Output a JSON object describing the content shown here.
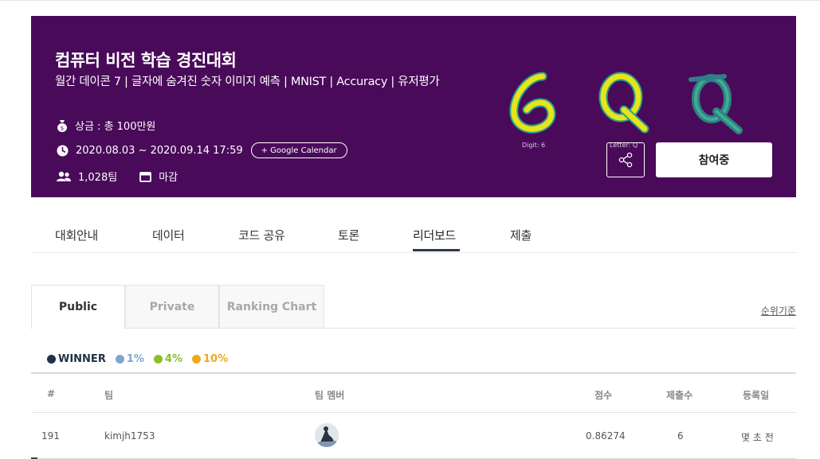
{
  "banner": {
    "title": "컴퓨터 비전 학습 경진대회",
    "subtitle": "월간 데이콘 7 | 글자에 숨겨진 숫자 이미지 예측 | MNIST | Accuracy | 유저평가",
    "prize": "상금 : 총 100만원",
    "period": "2020.08.03 ~ 2020.09.14 17:59",
    "calendar_button": "+ Google Calendar",
    "teams": "1,028팀",
    "status": "마감",
    "caption_digit": "Digit: 6",
    "caption_letter": "Letter: Q",
    "share_icon": "share-icon",
    "join_button": "참여중",
    "colors": {
      "background": "#4a0a5a",
      "digit_fill": "#e5e51a",
      "digit_edge": "#2a9d8f"
    }
  },
  "nav": {
    "items": [
      "대회안내",
      "데이터",
      "코드 공유",
      "토론",
      "리더보드",
      "제출"
    ],
    "active_index": 4
  },
  "leaderboard": {
    "tabs": [
      "Public",
      "Private",
      "Ranking Chart"
    ],
    "active_tab": 0,
    "sort_link": "순위기준",
    "legend": [
      {
        "label": "WINNER",
        "color": "#1f3147"
      },
      {
        "label": "1%",
        "color": "#7ba7cf"
      },
      {
        "label": "4%",
        "color": "#8cbf26"
      },
      {
        "label": "10%",
        "color": "#f0a81c"
      }
    ],
    "columns": [
      "#",
      "팀",
      "팀 멤버",
      "점수",
      "제출수",
      "등록일"
    ],
    "rows": [
      {
        "rank": "191",
        "team": "kimjh1753",
        "score": "0.86274",
        "submissions": "6",
        "registered": "몇 초 전"
      }
    ]
  }
}
